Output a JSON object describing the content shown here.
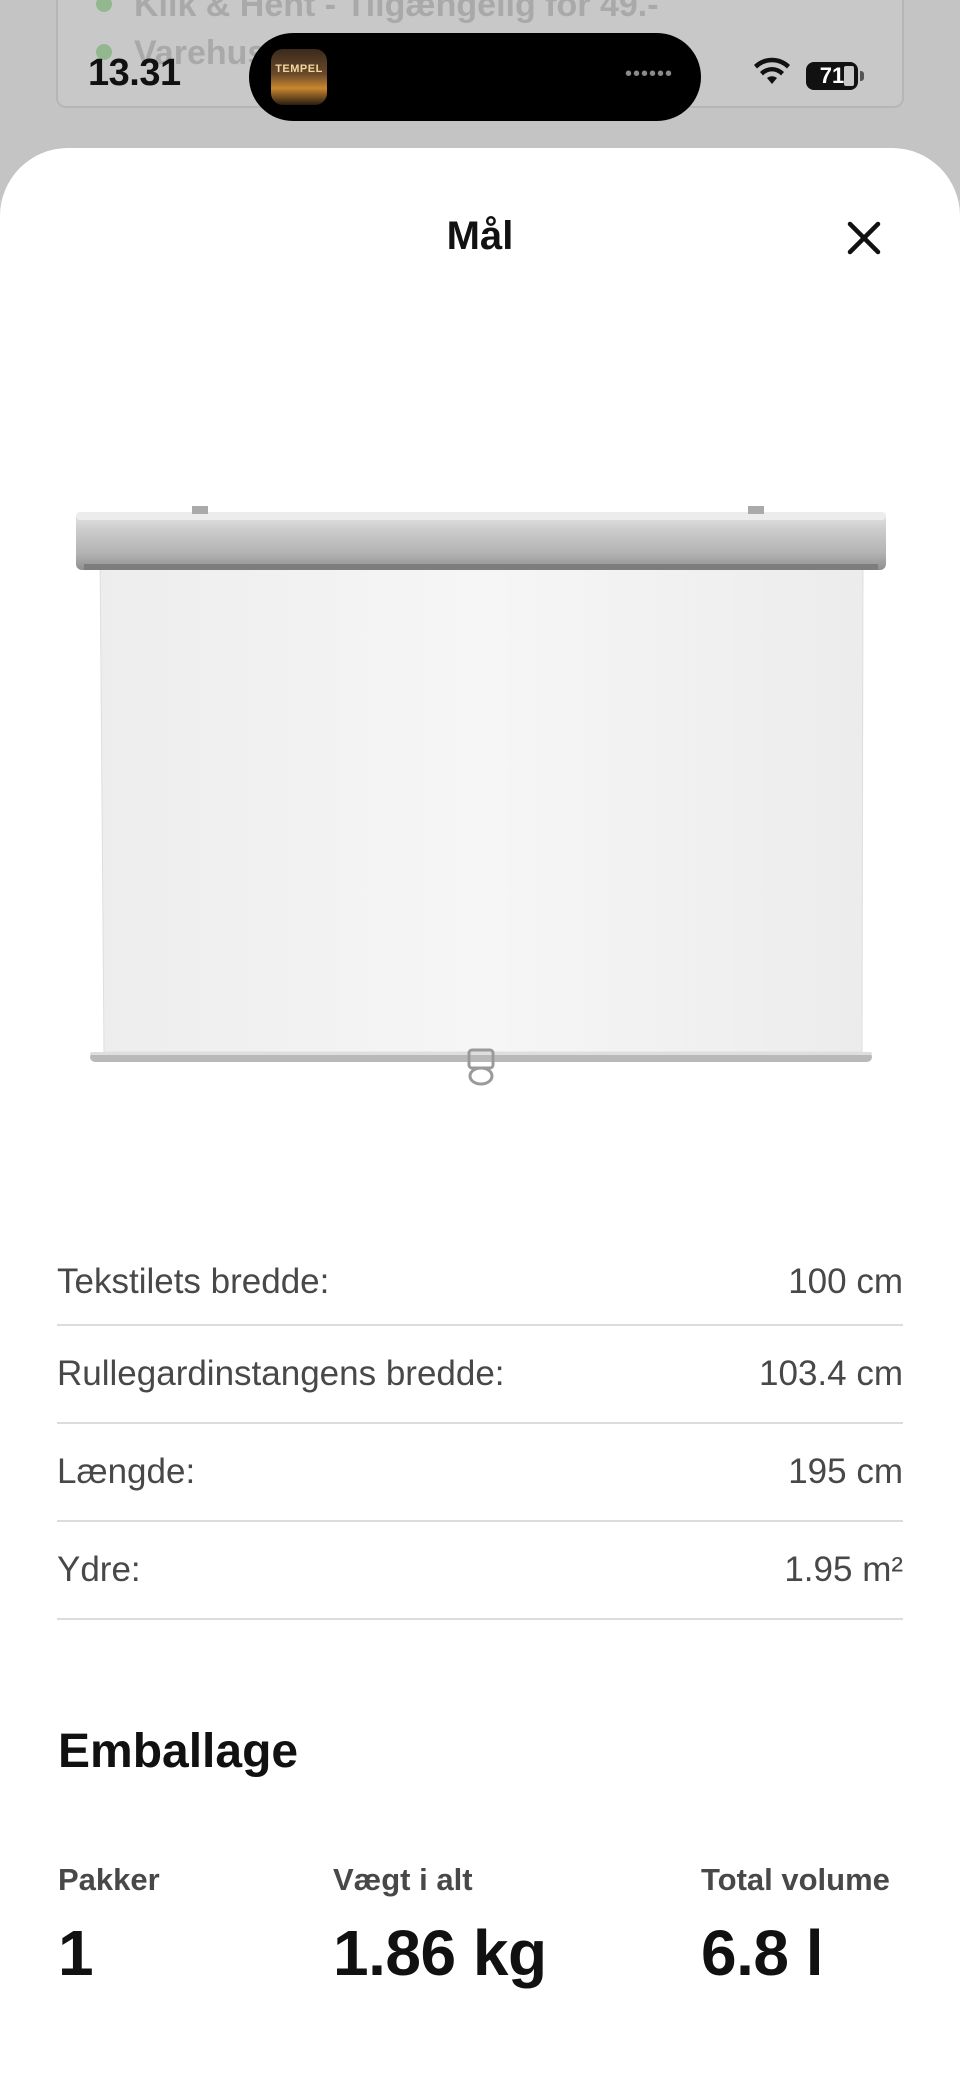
{
  "background": {
    "line1": "Klik & Hent - Tilgængelig for 49.-",
    "line2": "Varehus"
  },
  "status_bar": {
    "time": "13.31",
    "now_playing_art_text": "TEMPEL",
    "battery": "71"
  },
  "sheet": {
    "title": "Mål",
    "close_icon": "close-icon"
  },
  "dimensions": [
    {
      "label": "Tekstilets bredde:",
      "value": "100 cm"
    },
    {
      "label": "Rullegardinstangens bredde:",
      "value": "103.4 cm"
    },
    {
      "label": "Længde:",
      "value": "195 cm"
    },
    {
      "label": "Ydre:",
      "value": "1.95 m²"
    }
  ],
  "packaging": {
    "title": "Emballage",
    "packages_label": "Pakker",
    "packages_value": "1",
    "weight_label": "Vægt i alt",
    "weight_value": "1.86 kg",
    "volume_label": "Total volume",
    "volume_value": "6.8 l"
  },
  "colors": {
    "sheet_background": "#ffffff",
    "overlay": "#c9c9c9",
    "text_primary": "#111111",
    "text_secondary": "#484848",
    "divider": "#dcdcdc"
  }
}
